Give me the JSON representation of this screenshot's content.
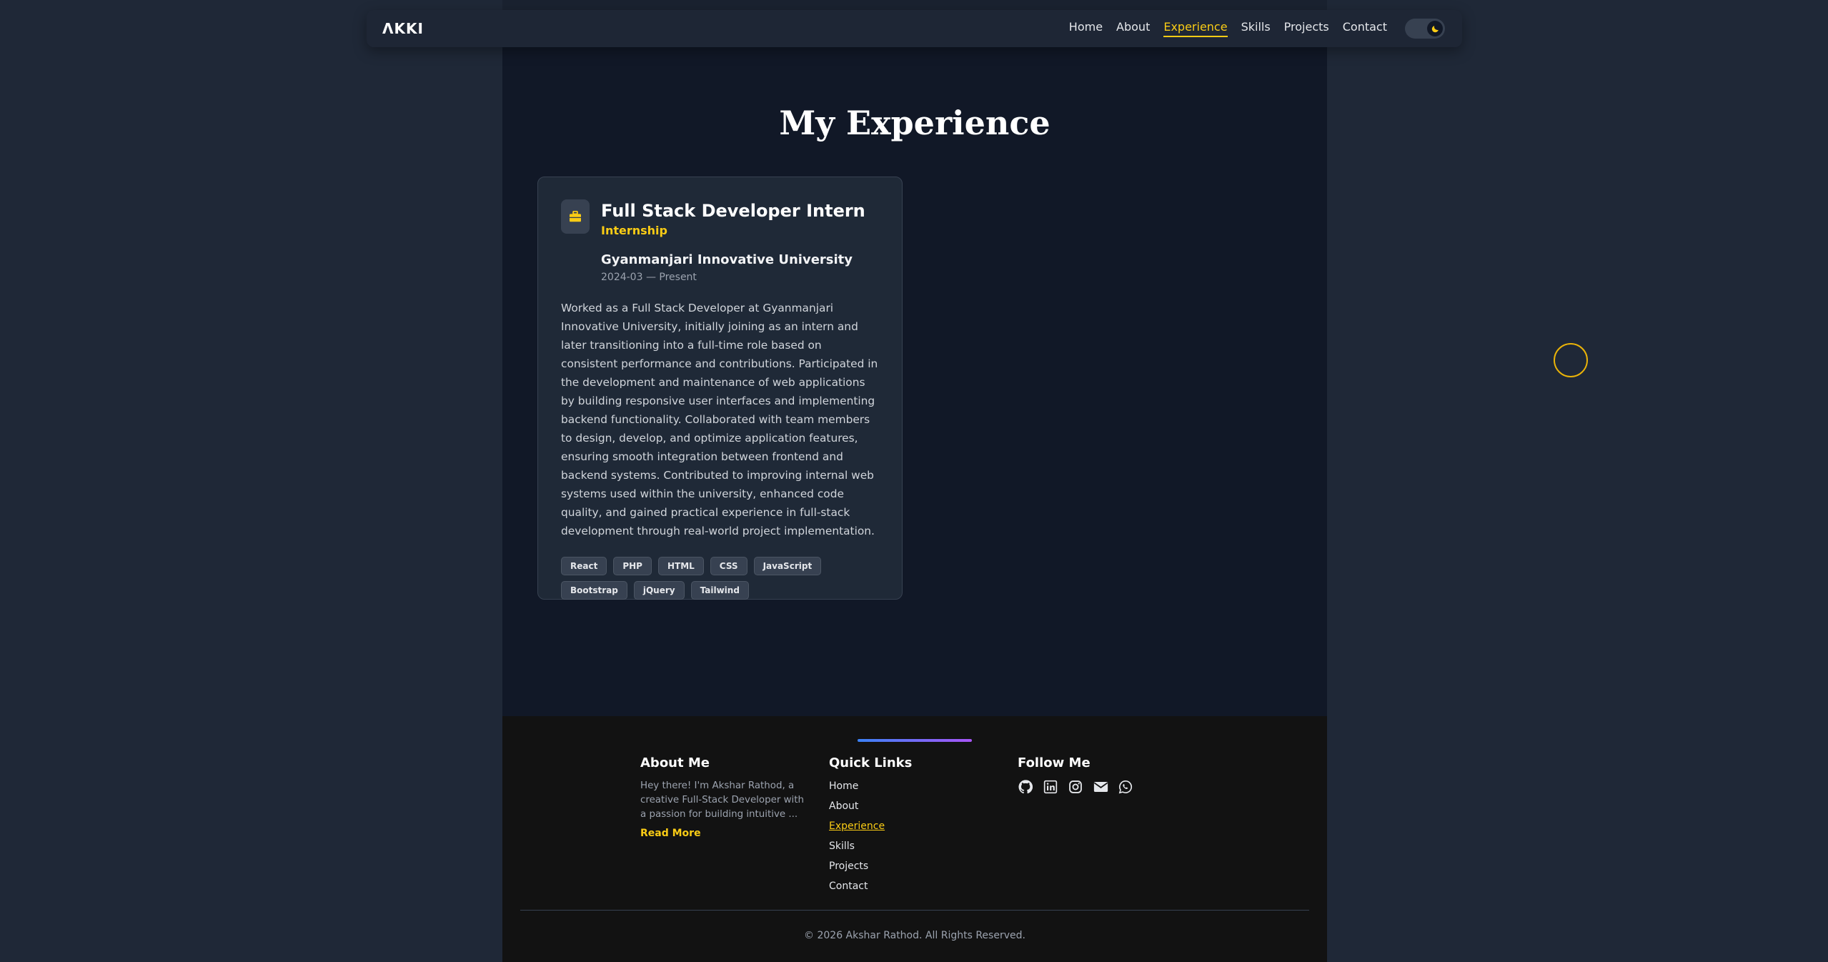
{
  "nav": {
    "logo": "ΛKKI",
    "links": [
      "Home",
      "About",
      "Experience",
      "Skills",
      "Projects",
      "Contact"
    ],
    "active_link": "Experience",
    "theme_toggle_icon": "moon-icon"
  },
  "main": {
    "title": "My Experience",
    "experience": {
      "title": "Full Stack Developer Intern",
      "type": "Internship",
      "company": "Gyanmanjari Innovative University",
      "dates": "2024-03 — Present",
      "description": "Worked as a Full Stack Developer at Gyanmanjari Innovative University, initially joining as an intern and later transitioning into a full-time role based on consistent performance and contributions. Participated in the development and maintenance of web applications by building responsive user interfaces and implementing backend functionality. Collaborated with team members to design, develop, and optimize application features, ensuring smooth integration between frontend and backend systems. Contributed to improving internal web systems used within the university, enhanced code quality, and gained practical experience in full-stack development through real-world project implementation.",
      "tags": [
        "React",
        "PHP",
        "HTML",
        "CSS",
        "JavaScript",
        "Bootstrap",
        "jQuery",
        "Tailwind"
      ],
      "icon": "briefcase-icon"
    }
  },
  "footer": {
    "about": {
      "heading": "About Me",
      "text": "Hey there! I'm Akshar Rathod, a creative Full-Stack Developer with a passion for building intuitive ...",
      "read_more": "Read More"
    },
    "quick_links": {
      "heading": "Quick Links",
      "items": [
        "Home",
        "About",
        "Experience",
        "Skills",
        "Projects",
        "Contact"
      ]
    },
    "follow": {
      "heading": "Follow Me",
      "icons": [
        "github-icon",
        "linkedin-icon",
        "instagram-icon",
        "email-icon",
        "whatsapp-icon"
      ]
    },
    "copyright": "© 2026  Akshar Rathod. All Rights Reserved."
  },
  "colors": {
    "accent": "#facc15",
    "page_bg": "#1f2837",
    "column_bg": "#111827",
    "card_bg": "#1f2937",
    "footer_bg": "#121212"
  }
}
